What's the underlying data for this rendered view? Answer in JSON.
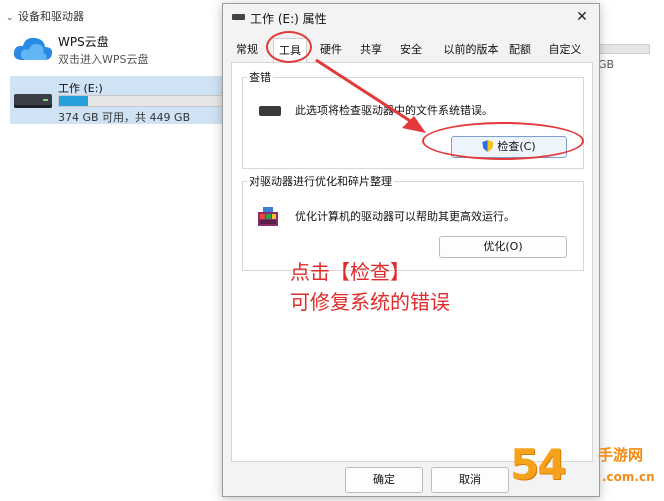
{
  "explorer": {
    "section_header": "设备和驱动器",
    "wps": {
      "title": "WPS云盘",
      "subtitle": "双击进入WPS云盘"
    },
    "drive": {
      "title": "工作 (E:)",
      "usage": "374 GB 可用，共 449 GB",
      "used_fraction": 0.17
    },
    "background_gb": "GB"
  },
  "dialog": {
    "title": "工作 (E:) 属性",
    "close_glyph": "✕",
    "tabs": [
      "常规",
      "工具",
      "硬件",
      "共享",
      "安全",
      "以前的版本",
      "配额",
      "自定义"
    ],
    "active_tab": "工具",
    "error_check": {
      "group_title": "查错",
      "description": "此选项将检查驱动器中的文件系统错误。",
      "button": "检查(C)"
    },
    "optimize": {
      "group_title": "对驱动器进行优化和碎片整理",
      "description": "优化计算机的驱动器可以帮助其更高效运行。",
      "button": "优化(O)"
    },
    "footer": {
      "ok": "确定",
      "cancel": "取消"
    }
  },
  "annotation": {
    "line1": "点击【检查】",
    "line2": "可修复系统的错误",
    "color": "#e12b2b"
  },
  "watermark": {
    "number": "54",
    "site": "手游网",
    "domain": ".com.cn",
    "color": "#f6a21c"
  },
  "colors": {
    "selection": "#cfe3f5",
    "drive_bar": "#26a0da",
    "accent_red": "#e23a3a"
  }
}
